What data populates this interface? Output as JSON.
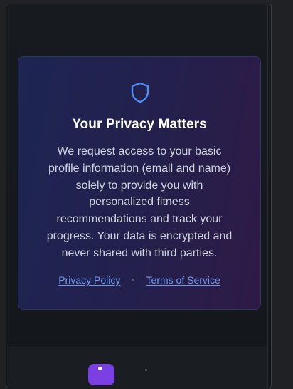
{
  "privacy_card": {
    "icon": "shield-icon",
    "title": "Your Privacy Matters",
    "lines": [
      "We request access to your basic",
      "profile information (email and name)",
      "solely to provide you with",
      "personalized fitness",
      "recommendations and track your",
      "progress. Your data is encrypted and",
      "never shared with third parties."
    ],
    "links": {
      "privacy_policy": "Privacy Policy",
      "separator": "•",
      "terms_of_service": "Terms of Service"
    }
  },
  "colors": {
    "accent_link": "#6e98f0",
    "shield_stroke": "#4f8ef7",
    "card_gradient_start": "#1d2553",
    "card_gradient_end": "#2f1a46",
    "app_icon": "#7b3fe4"
  },
  "bottom_bar": {
    "app_icon": "app-logo-icon"
  }
}
